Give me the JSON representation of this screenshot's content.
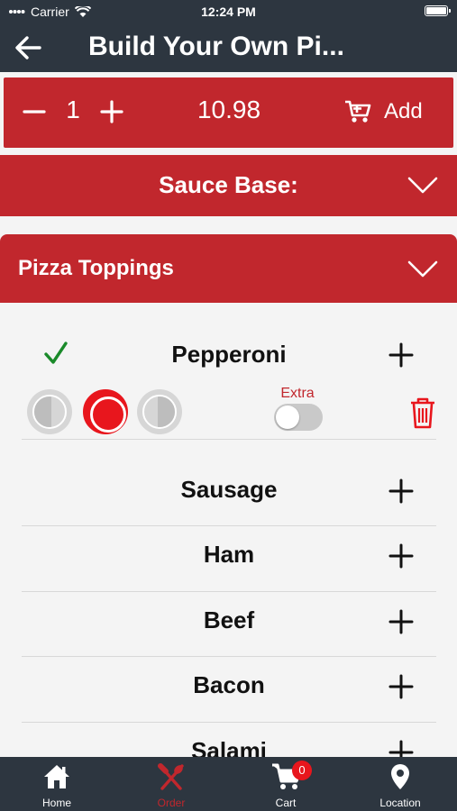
{
  "status": {
    "carrier": "Carrier",
    "time": "12:24 PM"
  },
  "header": {
    "title": "Build Your Own Pi..."
  },
  "order": {
    "quantity": "1",
    "price": "10.98",
    "add_label": "Add"
  },
  "sauce": {
    "label": "Sauce Base:"
  },
  "toppings": {
    "label": "Pizza Toppings",
    "selected": {
      "name": "Pepperoni",
      "extra_label": "Extra",
      "extra_on": false,
      "portion": "whole"
    },
    "items": [
      {
        "name": "Sausage"
      },
      {
        "name": "Ham"
      },
      {
        "name": "Beef"
      },
      {
        "name": "Bacon"
      },
      {
        "name": "Salami"
      }
    ]
  },
  "tabbar": {
    "tabs": [
      {
        "label": "Home",
        "icon": "home-icon"
      },
      {
        "label": "Order",
        "icon": "utensils-icon",
        "active": true
      },
      {
        "label": "Cart",
        "icon": "cart-icon",
        "badge": "0"
      },
      {
        "label": "Location",
        "icon": "location-pin-icon"
      }
    ]
  },
  "colors": {
    "brand_red": "#c1272d",
    "dark": "#2d3640",
    "check_green": "#1a8a2a"
  }
}
